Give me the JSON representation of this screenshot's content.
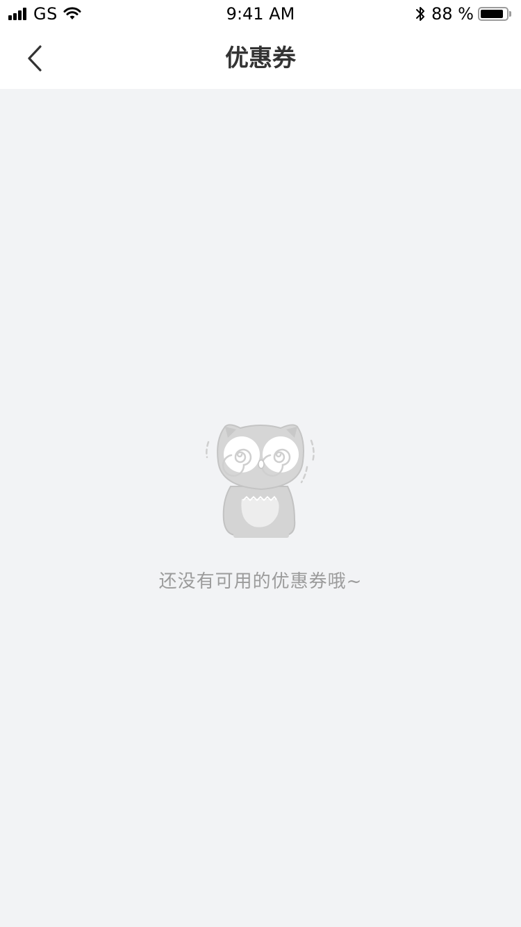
{
  "status_bar": {
    "carrier": "GS",
    "time": "9:41 AM",
    "battery_percent": "88 %",
    "battery_level": 0.88,
    "signal_icon": "cellular-signal-icon",
    "wifi_icon": "wifi-icon",
    "bluetooth_icon": "bluetooth-icon",
    "battery_icon": "battery-icon"
  },
  "nav_bar": {
    "title": "优惠券",
    "back_icon": "chevron-left-icon"
  },
  "empty_state": {
    "illustration": "dizzy-owl-illustration",
    "message": "还没有可用的优惠券哦~"
  },
  "colors": {
    "background": "#f2f3f5",
    "header_background": "#ffffff",
    "title_text": "#333333",
    "empty_text": "#9b9b9b",
    "illustration_gray": "#d6d6d6"
  }
}
